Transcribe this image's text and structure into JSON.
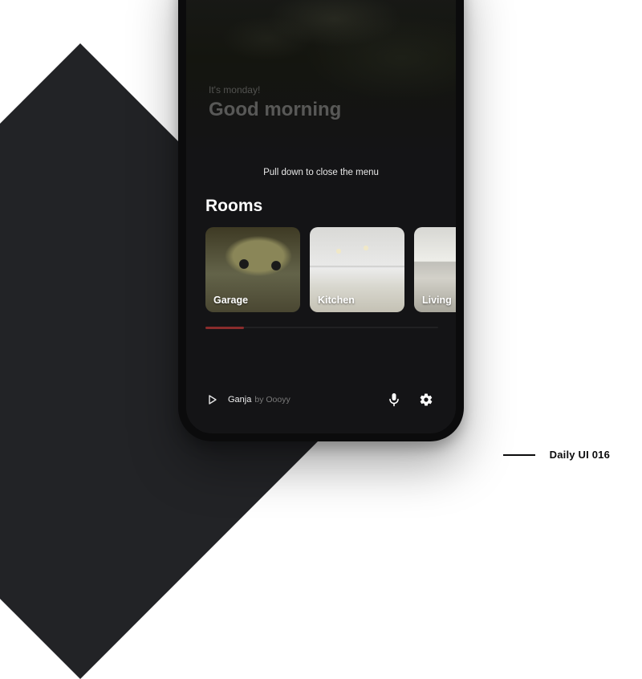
{
  "hero": {
    "subtitle": "It's monday!",
    "title": "Good morning"
  },
  "pull_hint": "Pull down to close the menu",
  "rooms_heading": "Rooms",
  "rooms": [
    {
      "label": "Garage"
    },
    {
      "label": "Kitchen"
    },
    {
      "label": "Living"
    }
  ],
  "now_playing": {
    "title": "Ganja",
    "by_prefix": "by",
    "artist": "Oooyy"
  },
  "footer": {
    "label": "Daily UI 016"
  }
}
